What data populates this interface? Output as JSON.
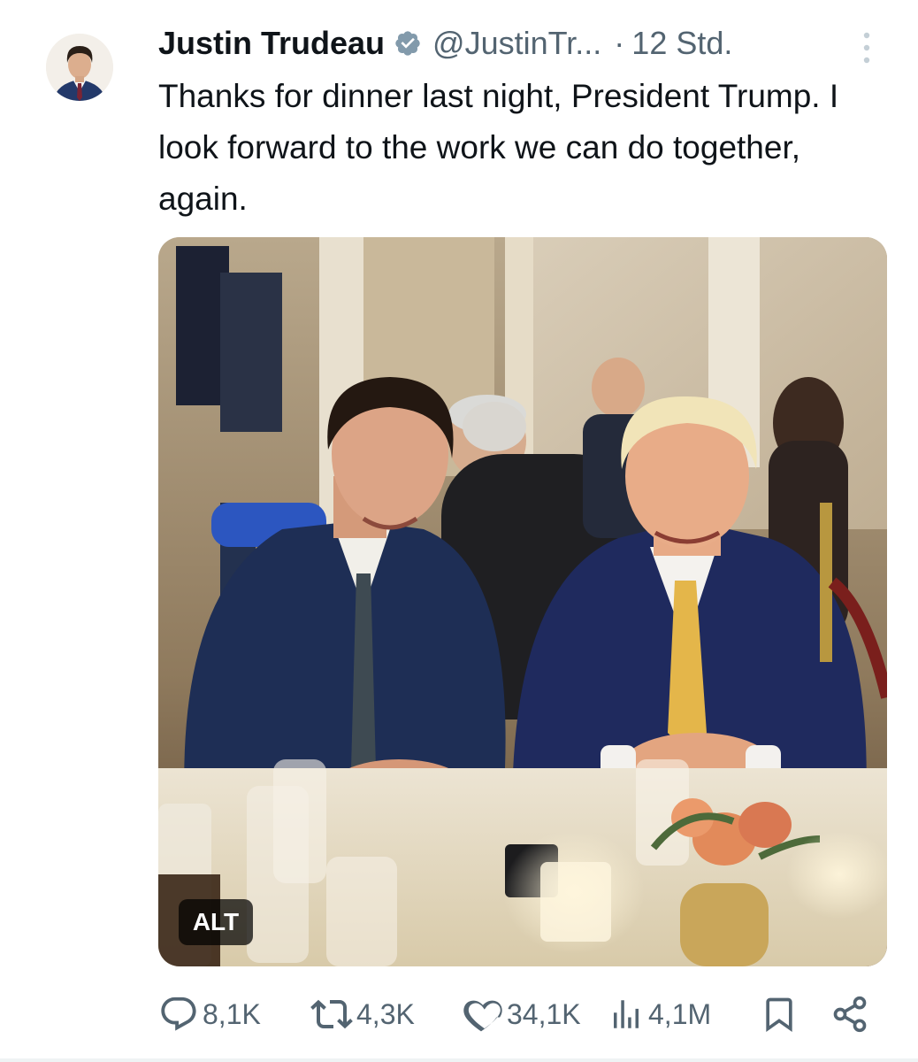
{
  "author": {
    "name": "Justin Trudeau",
    "handle": "@JustinTr...",
    "separator": "·",
    "time": "12 Std.",
    "verified": true
  },
  "tweet": {
    "text": "Thanks for dinner last night, President Trump. I look forward to the work we can do together, again."
  },
  "media": {
    "alt_badge": "ALT"
  },
  "actions": {
    "replies": "8,1K",
    "reposts": "4,3K",
    "likes": "34,1K",
    "views": "4,1M"
  },
  "icons": {
    "verified": "verified-badge-icon",
    "more": "more-vertical-icon",
    "reply": "reply-bubble-icon",
    "repost": "repost-arrows-icon",
    "like": "heart-icon",
    "views": "bar-chart-icon",
    "bookmark": "bookmark-icon",
    "share": "share-icon"
  },
  "colors": {
    "text": "#0f1419",
    "secondary": "#536471",
    "verified": "#829aab"
  }
}
